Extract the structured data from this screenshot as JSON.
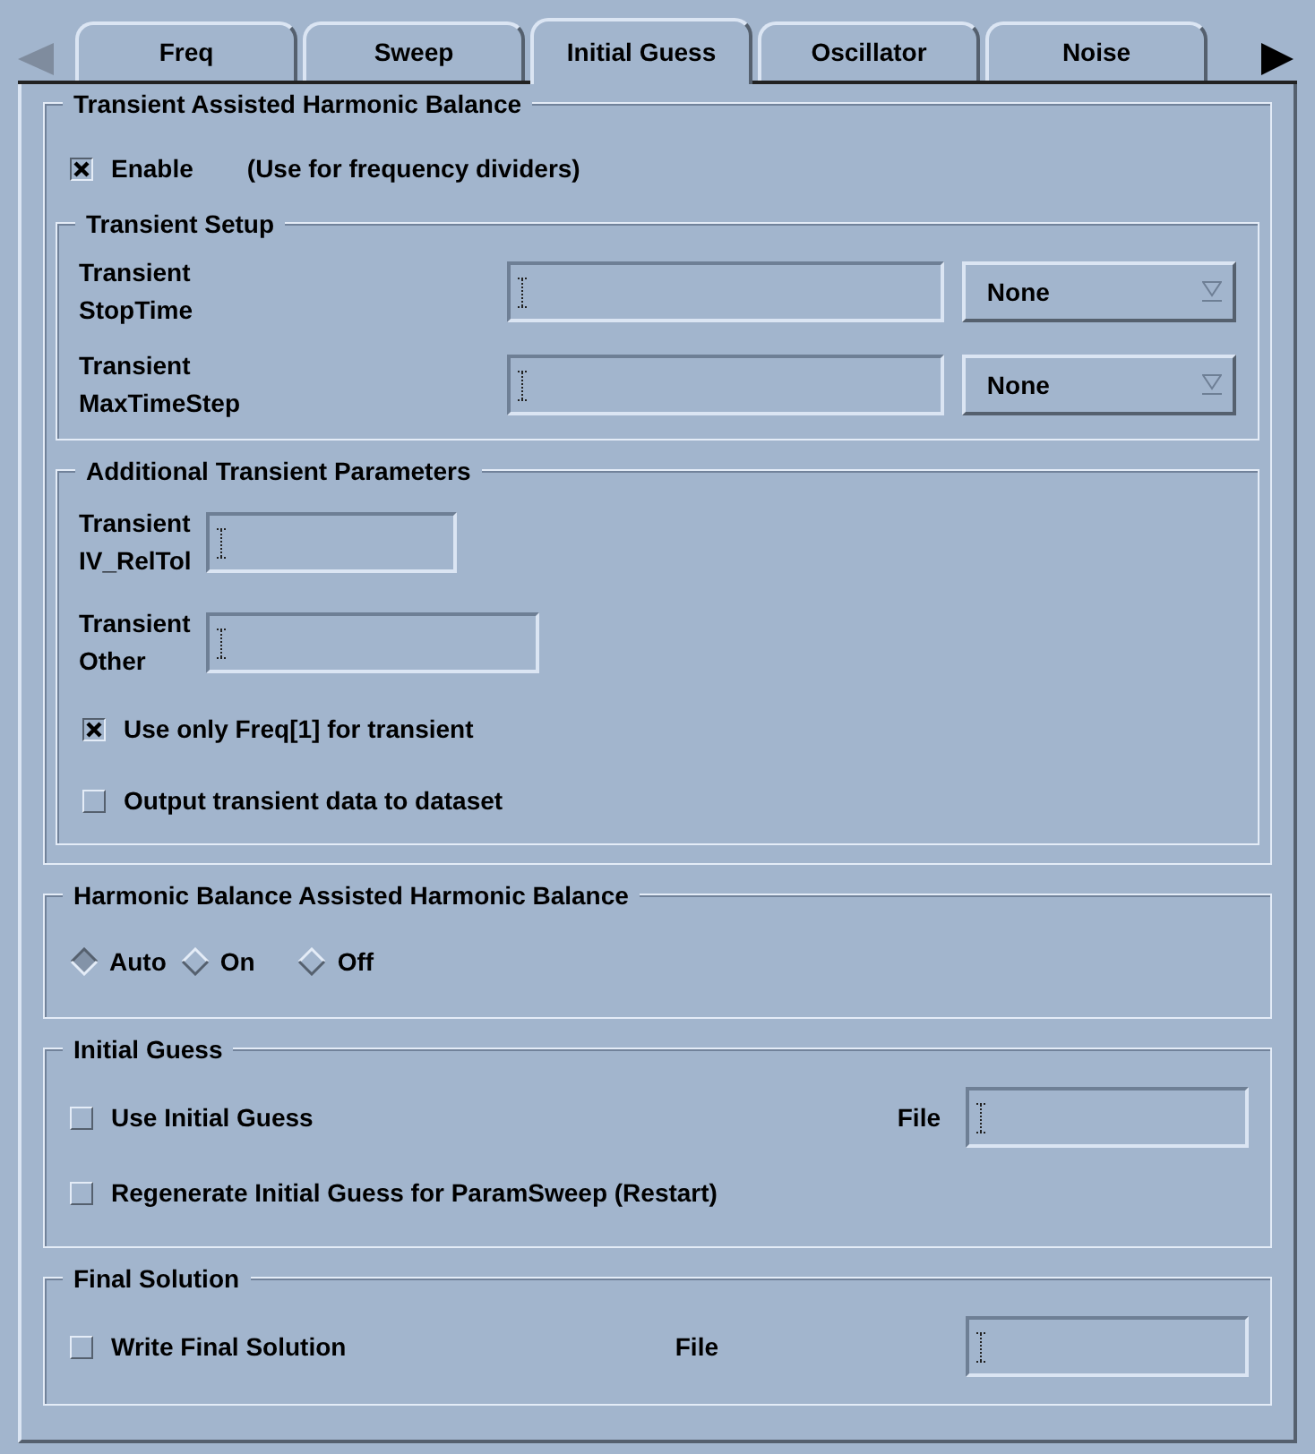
{
  "tabs": [
    {
      "label": "Freq",
      "selected": false
    },
    {
      "label": "Sweep",
      "selected": false
    },
    {
      "label": "Initial Guess",
      "selected": true
    },
    {
      "label": "Oscillator",
      "selected": false
    },
    {
      "label": "Noise",
      "selected": false
    }
  ],
  "scroll_left": {
    "disabled": true
  },
  "scroll_right": {
    "disabled": false
  },
  "sections": [
    {
      "title": "Transient Assisted Harmonic Balance",
      "rows": [
        {
          "kind": "checkbox",
          "label": "Enable",
          "note": "(Use for frequency dividers)",
          "checked": true
        }
      ],
      "subsections": [
        {
          "title": "Transient Setup",
          "rows": [
            {
              "kind": "field_select",
              "label": "Transient\nStopTime",
              "select": "None"
            },
            {
              "kind": "field_select",
              "label": "Transient\nMaxTimeStep",
              "select": "None"
            }
          ]
        },
        {
          "title": "Additional Transient Parameters",
          "rows": [
            {
              "kind": "field_short",
              "label": "Transient\nIV_RelTol"
            },
            {
              "kind": "field_medium",
              "label": "Transient\nOther"
            },
            {
              "kind": "checkbox",
              "label": "Use only Freq[1] for transient",
              "checked": true
            },
            {
              "kind": "checkbox",
              "label": "Output transient data to dataset",
              "checked": false
            }
          ]
        }
      ]
    },
    {
      "title": "Harmonic Balance Assisted Harmonic Balance",
      "rows": [
        {
          "kind": "radios",
          "options": [
            {
              "label": "Auto",
              "selected": true
            },
            {
              "label": "On",
              "selected": false
            },
            {
              "label": "Off",
              "selected": false
            }
          ]
        }
      ]
    },
    {
      "title": "Initial Guess",
      "rows": [
        {
          "kind": "checkbox_file",
          "label": "Use Initial Guess",
          "checked": false,
          "file_label": "File"
        },
        {
          "kind": "checkbox",
          "label": "Regenerate Initial Guess for ParamSweep (Restart)",
          "checked": false
        }
      ]
    },
    {
      "title": "Final Solution",
      "rows": [
        {
          "kind": "checkbox_file_mid",
          "label": "Write Final Solution",
          "checked": false,
          "file_label": "File"
        }
      ]
    }
  ]
}
